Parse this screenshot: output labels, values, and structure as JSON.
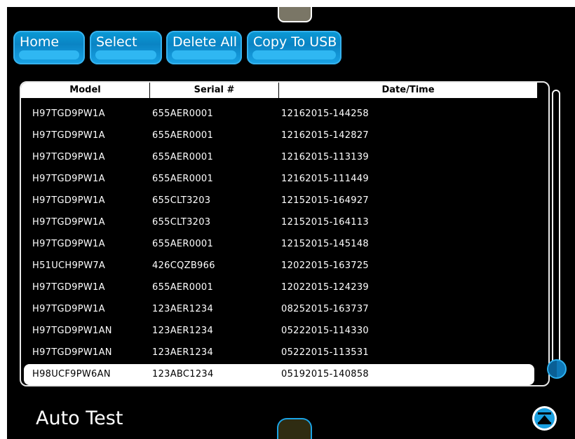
{
  "toolbar": {
    "home_label": "Home",
    "select_label": "Select",
    "delete_all_label": "Delete All",
    "copy_usb_label": "Copy To USB"
  },
  "table": {
    "columns": [
      "Model",
      "Serial #",
      "Date/Time"
    ],
    "rows": [
      {
        "model": "H97TGD9PW1A",
        "serial": "655AER0001",
        "datetime": "12162015-144258"
      },
      {
        "model": "H97TGD9PW1A",
        "serial": "655AER0001",
        "datetime": "12162015-142827"
      },
      {
        "model": "H97TGD9PW1A",
        "serial": "655AER0001",
        "datetime": "12162015-113139"
      },
      {
        "model": "H97TGD9PW1A",
        "serial": "655AER0001",
        "datetime": "12162015-111449"
      },
      {
        "model": "H97TGD9PW1A",
        "serial": "655CLT3203",
        "datetime": "12152015-164927"
      },
      {
        "model": "H97TGD9PW1A",
        "serial": "655CLT3203",
        "datetime": "12152015-164113"
      },
      {
        "model": "H97TGD9PW1A",
        "serial": "655AER0001",
        "datetime": "12152015-145148"
      },
      {
        "model": "H51UCH9PW7A",
        "serial": "426CQZB966",
        "datetime": "12022015-163725"
      },
      {
        "model": "H97TGD9PW1A",
        "serial": "655AER0001",
        "datetime": "12022015-124239"
      },
      {
        "model": "H97TGD9PW1A",
        "serial": "123AER1234",
        "datetime": "08252015-163737"
      },
      {
        "model": "H97TGD9PW1AN",
        "serial": "123AER1234",
        "datetime": "05222015-114330"
      },
      {
        "model": "H97TGD9PW1AN",
        "serial": "123AER1234",
        "datetime": "05222015-113531"
      },
      {
        "model": "H98UCF9PW6AN",
        "serial": "123ABC1234",
        "datetime": "05192015-140858",
        "selected": true
      }
    ]
  },
  "footer": {
    "mode_title": "Auto Test",
    "eject_icon": "eject-up-icon"
  },
  "colors": {
    "accent": "#1a9fe0",
    "background": "#000000",
    "selected_row": "#ffffff"
  }
}
